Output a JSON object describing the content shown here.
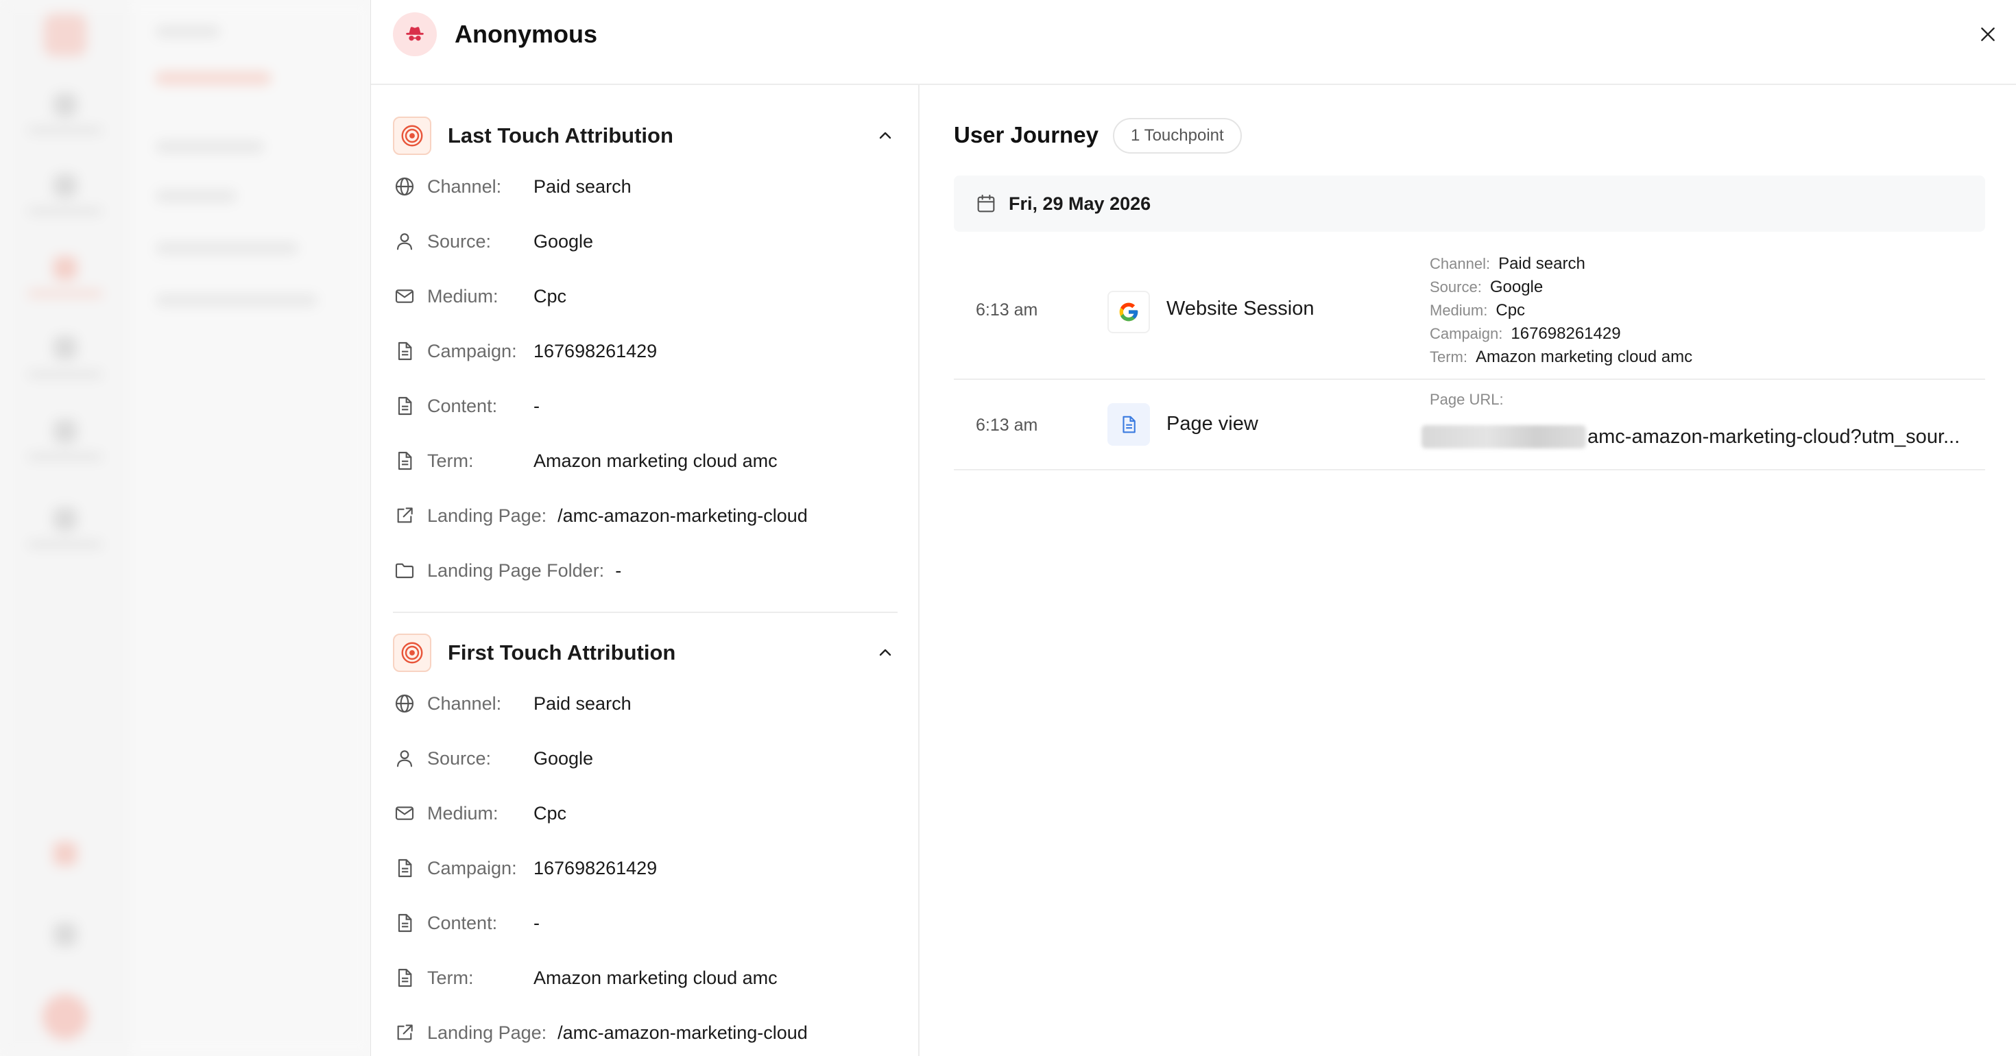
{
  "modal": {
    "title": "Anonymous"
  },
  "last_touch": {
    "title": "Last Touch Attribution",
    "rows": [
      {
        "label": "Channel:",
        "value": "Paid search"
      },
      {
        "label": "Source:",
        "value": "Google"
      },
      {
        "label": "Medium:",
        "value": "Cpc"
      },
      {
        "label": "Campaign:",
        "value": "167698261429"
      },
      {
        "label": "Content:",
        "value": "-"
      },
      {
        "label": "Term:",
        "value": "Amazon marketing cloud amc"
      },
      {
        "label": "Landing Page:",
        "value": "/amc-amazon-marketing-cloud"
      },
      {
        "label": "Landing Page Folder:",
        "value": "-"
      }
    ]
  },
  "first_touch": {
    "title": "First Touch Attribution",
    "rows": [
      {
        "label": "Channel:",
        "value": "Paid search"
      },
      {
        "label": "Source:",
        "value": "Google"
      },
      {
        "label": "Medium:",
        "value": "Cpc"
      },
      {
        "label": "Campaign:",
        "value": "167698261429"
      },
      {
        "label": "Content:",
        "value": "-"
      },
      {
        "label": "Term:",
        "value": "Amazon marketing cloud amc"
      },
      {
        "label": "Landing Page:",
        "value": "/amc-amazon-marketing-cloud"
      }
    ]
  },
  "journey": {
    "title": "User Journey",
    "badge": "1 Touchpoint",
    "date": "Fri, 29 May 2026",
    "events": [
      {
        "time": "6:13 am",
        "name": "Website Session",
        "icon": "google-icon",
        "details": [
          {
            "label": "Channel:",
            "value": "Paid search"
          },
          {
            "label": "Source:",
            "value": "Google"
          },
          {
            "label": "Medium:",
            "value": "Cpc"
          },
          {
            "label": "Campaign:",
            "value": "167698261429"
          },
          {
            "label": "Term:",
            "value": "Amazon marketing cloud amc"
          }
        ]
      },
      {
        "time": "6:13 am",
        "name": "Page view",
        "icon": "document-icon",
        "url_label": "Page URL:",
        "url_value": "amc-amazon-marketing-cloud?utm_sour..."
      }
    ]
  },
  "colors": {
    "accent": "#e8553a",
    "accent_soft": "#fff1ea",
    "avatar_bg": "#fde3e3",
    "avatar_icon": "#d9304a",
    "doc_icon": "#3b7be0"
  }
}
